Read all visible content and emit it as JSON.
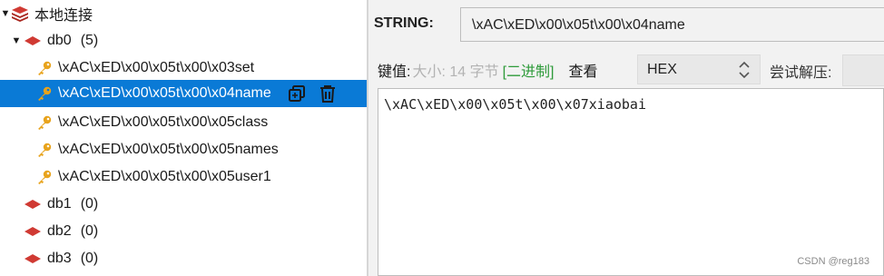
{
  "tree": {
    "connection_label": "本地连接",
    "db0": {
      "label": "db0",
      "count": "(5)"
    },
    "keys": [
      "\\xAC\\xED\\x00\\x05t\\x00\\x03set",
      "\\xAC\\xED\\x00\\x05t\\x00\\x04name",
      "\\xAC\\xED\\x00\\x05t\\x00\\x05class",
      "\\xAC\\xED\\x00\\x05t\\x00\\x05names",
      "\\xAC\\xED\\x00\\x05t\\x00\\x05user1"
    ],
    "db1": {
      "label": "db1",
      "count": "(0)"
    },
    "db2": {
      "label": "db2",
      "count": "(0)"
    },
    "db3": {
      "label": "db3",
      "count": "(0)"
    }
  },
  "detail": {
    "type_label": "STRING:",
    "key_name": "\\xAC\\xED\\x00\\x05t\\x00\\x04name",
    "value_label": "键值:",
    "size_text": "大小: 14 字节",
    "binary_tag": "[二进制]",
    "view_label": "查看",
    "view_value": "HEX",
    "try_decompress_label": "尝试解压:",
    "value_text": "\\xAC\\xED\\x00\\x05t\\x00\\x07xiaobai"
  },
  "watermark": "CSDN @reg183",
  "colors": {
    "selection": "#0a7ad6",
    "redis_red": "#d03a33",
    "key_orange": "#e8a31c",
    "binary_green": "#2e9b3a"
  }
}
